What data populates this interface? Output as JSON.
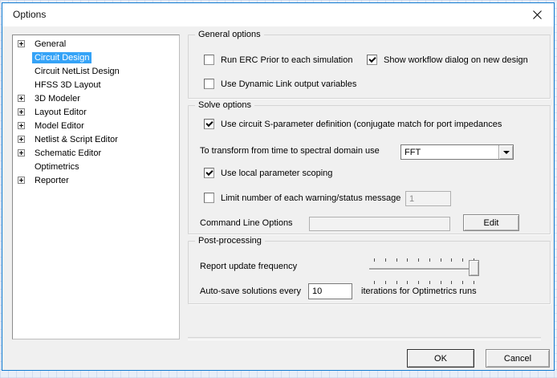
{
  "window": {
    "title": "Options"
  },
  "tree": {
    "items": [
      {
        "label": "General",
        "expandable": true,
        "selected": false
      },
      {
        "label": "Circuit Design",
        "expandable": false,
        "selected": true
      },
      {
        "label": "Circuit NetList Design",
        "expandable": false,
        "selected": false
      },
      {
        "label": "HFSS 3D Layout",
        "expandable": false,
        "selected": false
      },
      {
        "label": "3D Modeler",
        "expandable": true,
        "selected": false
      },
      {
        "label": "Layout Editor",
        "expandable": true,
        "selected": false
      },
      {
        "label": "Model Editor",
        "expandable": true,
        "selected": false
      },
      {
        "label": "Netlist & Script Editor",
        "expandable": true,
        "selected": false
      },
      {
        "label": "Schematic Editor",
        "expandable": true,
        "selected": false
      },
      {
        "label": "Optimetrics",
        "expandable": false,
        "selected": false
      },
      {
        "label": "Reporter",
        "expandable": true,
        "selected": false
      }
    ]
  },
  "general_options": {
    "title": "General options",
    "run_erc": {
      "label": "Run ERC Prior to each simulation",
      "checked": false
    },
    "show_workflow": {
      "label": "Show workflow dialog on new design",
      "checked": true
    },
    "dynamic_link": {
      "label": "Use Dynamic Link output variables",
      "checked": false
    }
  },
  "solve_options": {
    "title": "Solve options",
    "s_parameter": {
      "label": "Use circuit S-parameter definition (conjugate match for port  impedances",
      "checked": true
    },
    "transform": {
      "label": "To transform from time to spectral domain use",
      "value": "FFT"
    },
    "local_scoping": {
      "label": "Use local parameter scoping",
      "checked": true
    },
    "limit_warning": {
      "label": "Limit number of each warning/status message",
      "checked": false,
      "value": "1",
      "disabled": true
    },
    "command_line": {
      "label": "Command Line Options",
      "value": "",
      "edit_button": "Edit"
    }
  },
  "post_processing": {
    "title": "Post-processing",
    "report_update": {
      "label": "Report update frequency",
      "slider_position": "max"
    },
    "autosave": {
      "prefix": "Auto-save solutions every",
      "value": "10",
      "suffix": "iterations for Optimetrics runs"
    }
  },
  "footer": {
    "ok": "OK",
    "cancel": "Cancel"
  },
  "colors": {
    "accent": "#0f7ad1",
    "selection": "#35a3f7",
    "dialog_bg": "#f0f0f0"
  }
}
